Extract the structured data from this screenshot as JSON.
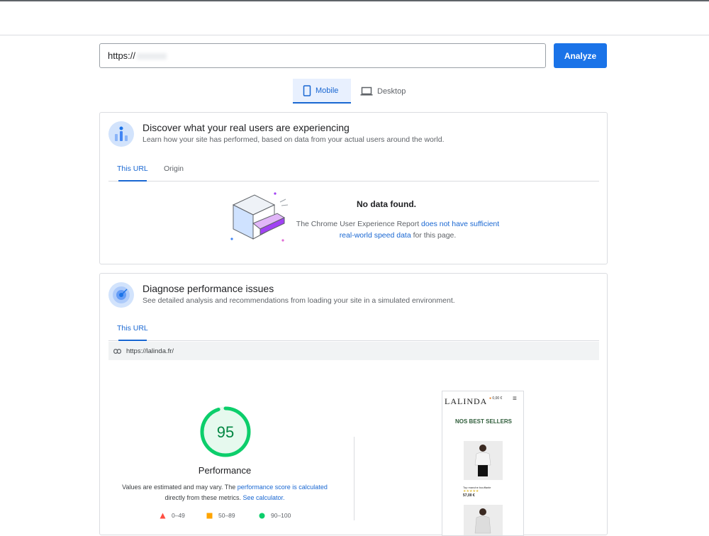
{
  "search": {
    "value": "https://",
    "analyze_label": "Analyze"
  },
  "device_tabs": {
    "mobile": "Mobile",
    "desktop": "Desktop"
  },
  "field_data": {
    "title": "Discover what your real users are experiencing",
    "subtitle": "Learn how your site has performed, based on data from your actual users around the world.",
    "tabs": [
      "This URL",
      "Origin"
    ],
    "no_data_title": "No data found.",
    "no_data_prefix": "The Chrome User Experience Report ",
    "no_data_link": "does not have sufficient real-world speed data",
    "no_data_suffix": " for this page."
  },
  "lab_data": {
    "title": "Diagnose performance issues",
    "subtitle": "See detailed analysis and recommendations from loading your site in a simulated environment.",
    "tabs": [
      "This URL"
    ],
    "tested_url": "https://lalinda.fr/",
    "score": "95",
    "score_fraction": 0.95,
    "category": "Performance",
    "note_prefix": "Values are estimated and may vary. The ",
    "note_link": "performance score is calculated",
    "note_middle": " directly from these metrics. ",
    "note_link2": "See calculator.",
    "legend": [
      "0–49",
      "50–89",
      "90–100"
    ],
    "colors": {
      "good": "#0cce6b",
      "average": "#ffa400",
      "poor": "#ff4e42"
    }
  },
  "screenshot": {
    "logo": "LALINDA",
    "cart": "0,00 €",
    "heading": "NOS BEST SELLERS",
    "product_name": "Top manche bouffante",
    "stars": "★★★★★",
    "price": "57,00 €"
  }
}
